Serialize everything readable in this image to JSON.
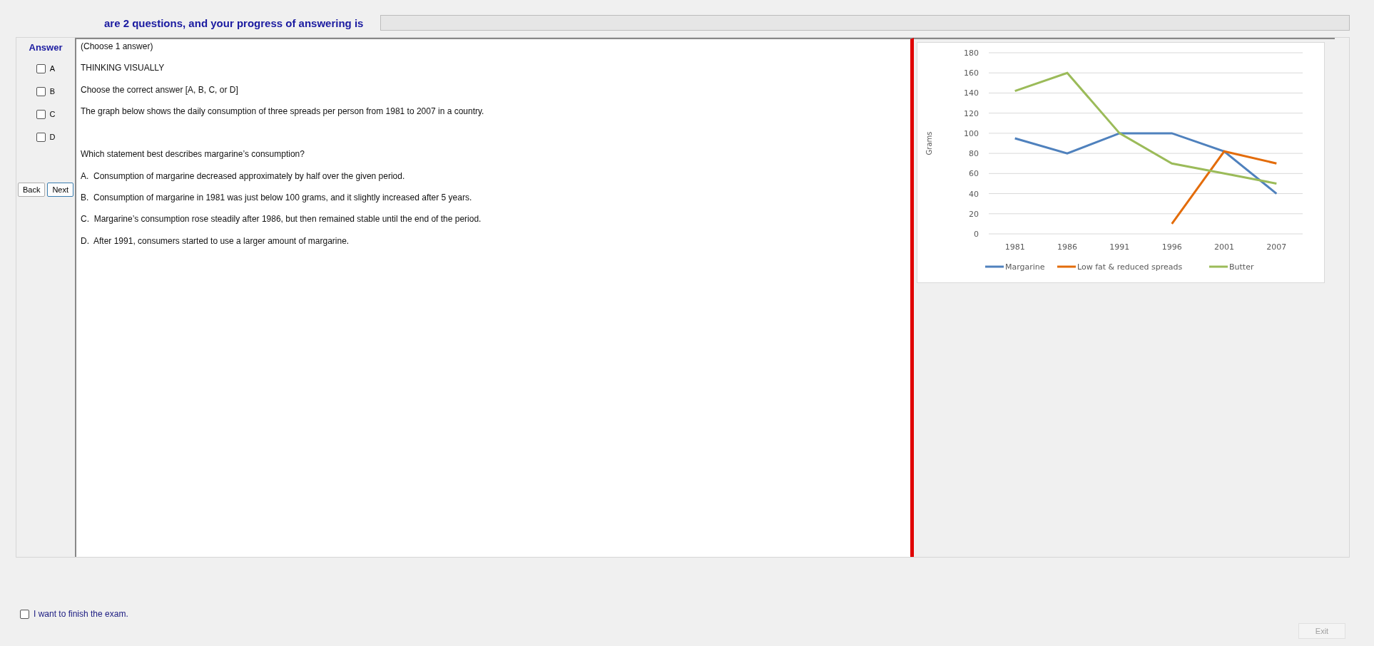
{
  "header": {
    "text": "are 2 questions, and your progress of answering is",
    "progress": {
      "level": 0
    }
  },
  "answer_panel": {
    "title": "Answer",
    "options": [
      {
        "label": "A",
        "checked": false
      },
      {
        "label": "B",
        "checked": false
      },
      {
        "label": "C",
        "checked": false
      },
      {
        "label": "D",
        "checked": false
      }
    ],
    "buttons": [
      "Back",
      "Next"
    ]
  },
  "question": {
    "intro": [
      "(Choose 1 answer)",
      "THINKING VISUALLY",
      "Choose the correct answer [A, B, C, or D]",
      "The graph below shows the daily consumption of three spreads per person from 1981 to 2007 in a country."
    ],
    "body": [
      "Which statement best describes margarine’s consumption?",
      "A.  Consumption of margarine decreased approximately by half over the given period.",
      "B.  Consumption of margarine in 1981 was just below 100 grams, and it slightly increased after 5 years.",
      "C.  Margarine’s consumption rose steadily after 1986, but then remained stable until the end of the period.",
      "D.  After 1991, consumers started to use a larger amount of margarine."
    ]
  },
  "chart": {
    "chart_data": {
      "type": "line",
      "ylabel": "Grams",
      "categories": [
        "1981",
        "1986",
        "1991",
        "1996",
        "2001",
        "2007"
      ],
      "ylim": [
        0,
        180
      ],
      "grid": true,
      "legend": true,
      "yticks": [
        0,
        20,
        40,
        60,
        80,
        100,
        120,
        140,
        160,
        180
      ],
      "series": [
        {
          "name": "Margarine",
          "color": "#4f81bd",
          "values": [
            95,
            80,
            100,
            100,
            82,
            40
          ]
        },
        {
          "name": "Low fat & reduced spreads",
          "color": "#e36c0a",
          "values": [
            null,
            null,
            null,
            10,
            82,
            70
          ]
        },
        {
          "name": "Butter",
          "color": "#9bbb59",
          "values": [
            142,
            160,
            100,
            70,
            60,
            50
          ]
        }
      ]
    }
  },
  "footer": {
    "finish": {
      "label": "I want to finish the exam.",
      "checked": false
    },
    "exit": {
      "label": "Exit",
      "disabled": true
    }
  }
}
